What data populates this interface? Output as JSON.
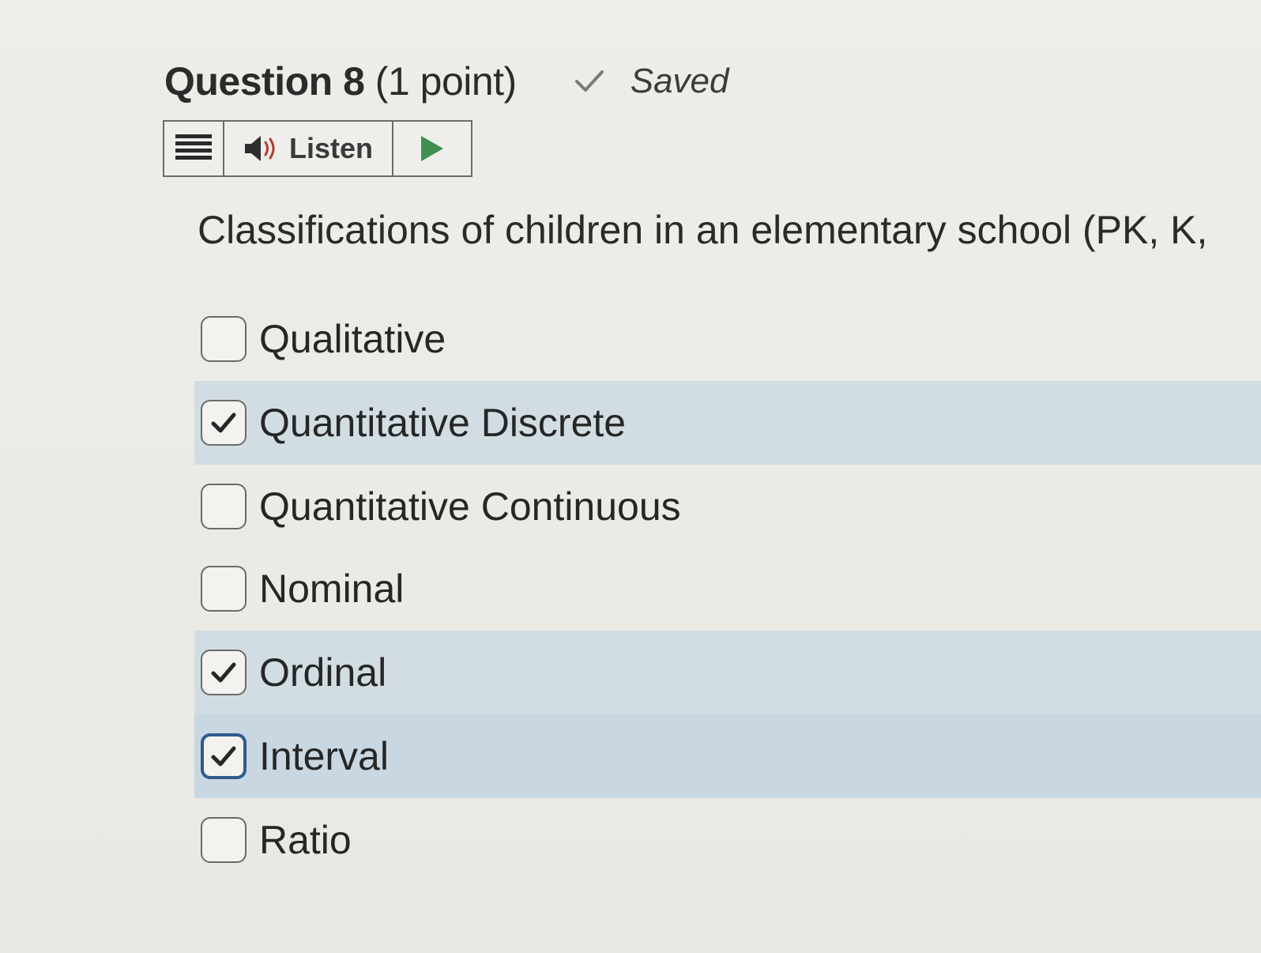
{
  "question": {
    "number_text": "Question 8",
    "points_text": "(1 point)",
    "status_text": "Saved",
    "prompt": "Classifications of children in an elementary school (PK, K,"
  },
  "toolbar": {
    "menu_icon": "menu-icon",
    "listen_label": "Listen",
    "speaker_icon": "speaker-icon",
    "play_icon": "play-icon"
  },
  "options": [
    {
      "label": "Qualitative",
      "checked": false
    },
    {
      "label": "Quantitative Discrete",
      "checked": true
    },
    {
      "label": "Quantitative Continuous",
      "checked": false
    },
    {
      "label": "Nominal",
      "checked": false
    },
    {
      "label": "Ordinal",
      "checked": true
    },
    {
      "label": "Interval",
      "checked": true,
      "focused": true
    },
    {
      "label": "Ratio",
      "checked": false
    }
  ],
  "colors": {
    "selected_row": "#d2dde3",
    "focused_border": "#2f5b8f",
    "play_green": "#3f8f4f",
    "speaker_red": "#b23a2e"
  }
}
